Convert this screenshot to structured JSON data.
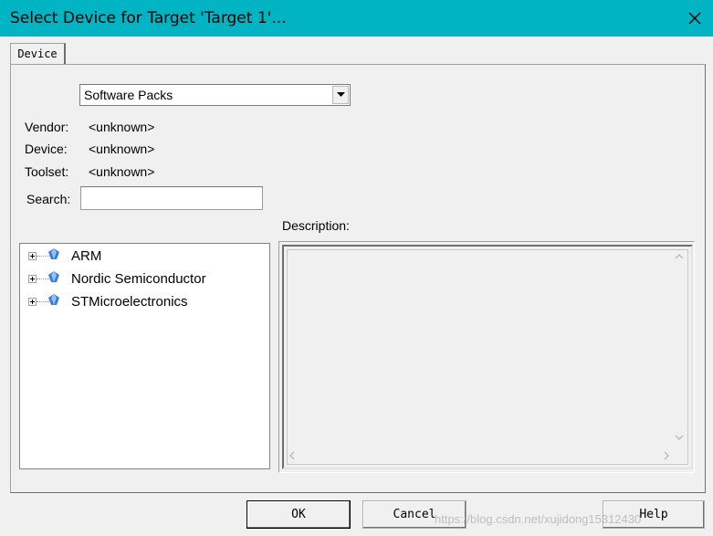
{
  "window": {
    "title": "Select Device for Target 'Target 1'..."
  },
  "tabs": [
    {
      "label": "Device"
    }
  ],
  "pack_selector": {
    "value": "Software Packs"
  },
  "info": {
    "vendor_label": "Vendor:",
    "vendor_value": "<unknown>",
    "device_label": "Device:",
    "device_value": "<unknown>",
    "toolset_label": "Toolset:",
    "toolset_value": "<unknown>"
  },
  "search": {
    "label": "Search:",
    "value": ""
  },
  "description": {
    "label": "Description:"
  },
  "tree": {
    "items": [
      {
        "label": "ARM",
        "icon": "chip-icon"
      },
      {
        "label": "Nordic Semiconductor",
        "icon": "chip-icon"
      },
      {
        "label": "STMicroelectronics",
        "icon": "chip-icon"
      }
    ]
  },
  "buttons": {
    "ok": "OK",
    "cancel": "Cancel",
    "help": "Help"
  },
  "watermark": "https://blog.csdn.net/xujidong15312430",
  "colors": {
    "titlebar": "#00b4c4",
    "background": "#f0f0f0",
    "chip_icon": "#3a7bd5"
  }
}
